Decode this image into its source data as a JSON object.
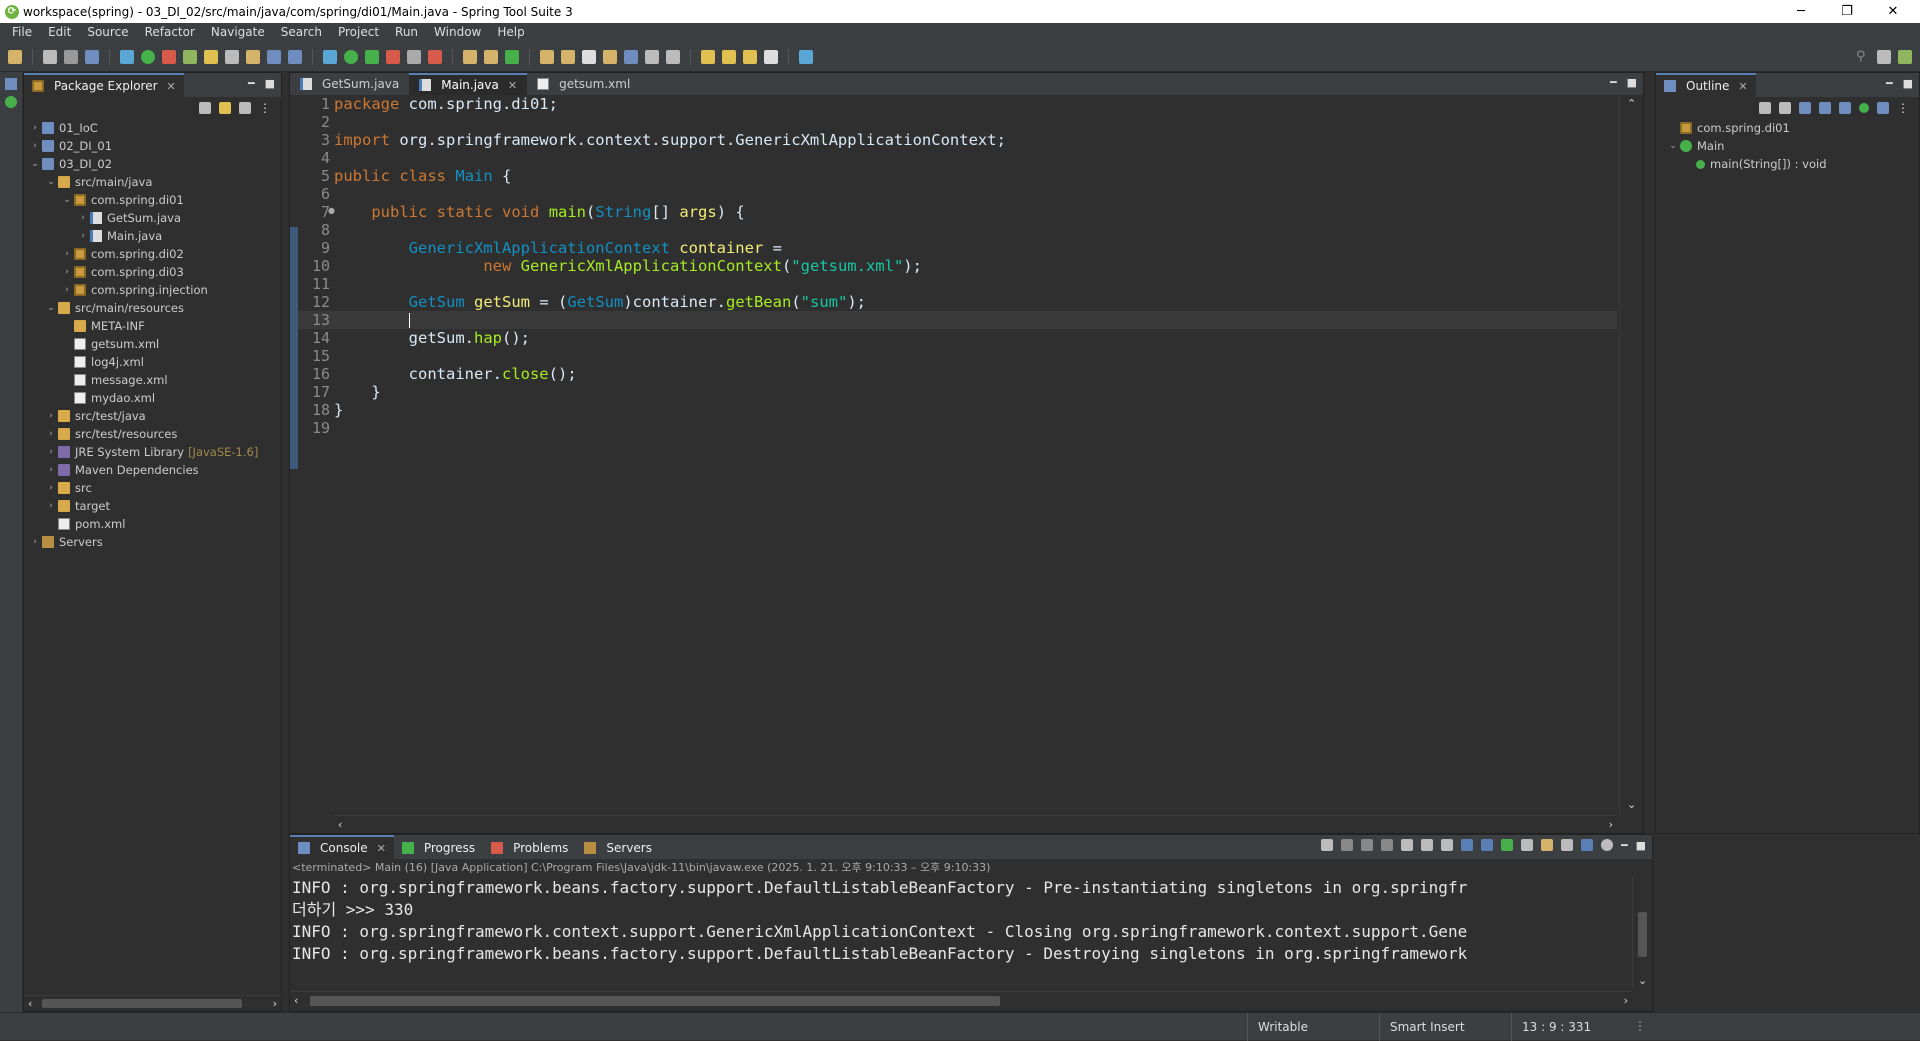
{
  "window": {
    "title": "workspace(spring) - 03_DI_02/src/main/java/com/spring/di01/Main.java - Spring Tool Suite 3",
    "minimize": "─",
    "maximize": "❐",
    "close": "✕"
  },
  "menu": [
    "File",
    "Edit",
    "Source",
    "Refactor",
    "Navigate",
    "Search",
    "Project",
    "Run",
    "Window",
    "Help"
  ],
  "package_explorer": {
    "title": "Package Explorer",
    "tree": [
      {
        "label": "01_IoC",
        "icon": "project-icon",
        "twisty": "›",
        "indent": 0
      },
      {
        "label": "02_DI_01",
        "icon": "project-icon",
        "twisty": "›",
        "indent": 0
      },
      {
        "label": "03_DI_02",
        "icon": "project-icon",
        "twisty": "⌄",
        "indent": 0
      },
      {
        "label": "src/main/java",
        "icon": "source-folder-icon",
        "twisty": "⌄",
        "indent": 1
      },
      {
        "label": "com.spring.di01",
        "icon": "package-icon",
        "twisty": "⌄",
        "indent": 2
      },
      {
        "label": "GetSum.java",
        "icon": "java-file-icon",
        "twisty": "›",
        "indent": 3
      },
      {
        "label": "Main.java",
        "icon": "java-file-icon",
        "twisty": "›",
        "indent": 3
      },
      {
        "label": "com.spring.di02",
        "icon": "package-icon",
        "twisty": "›",
        "indent": 2
      },
      {
        "label": "com.spring.di03",
        "icon": "package-icon",
        "twisty": "›",
        "indent": 2
      },
      {
        "label": "com.spring.injection",
        "icon": "package-icon",
        "twisty": "›",
        "indent": 2
      },
      {
        "label": "src/main/resources",
        "icon": "source-folder-icon",
        "twisty": "⌄",
        "indent": 1
      },
      {
        "label": "META-INF",
        "icon": "folder-icon",
        "twisty": "",
        "indent": 2
      },
      {
        "label": "getsum.xml",
        "icon": "xml-file-icon",
        "twisty": "",
        "indent": 2
      },
      {
        "label": "log4j.xml",
        "icon": "xml-file-icon",
        "twisty": "",
        "indent": 2
      },
      {
        "label": "message.xml",
        "icon": "xml-file-icon",
        "twisty": "",
        "indent": 2
      },
      {
        "label": "mydao.xml",
        "icon": "xml-file-icon",
        "twisty": "",
        "indent": 2
      },
      {
        "label": "src/test/java",
        "icon": "source-folder-icon",
        "twisty": "›",
        "indent": 1
      },
      {
        "label": "src/test/resources",
        "icon": "source-folder-icon",
        "twisty": "›",
        "indent": 1
      },
      {
        "label": "JRE System Library",
        "decoration": "[JavaSE-1.6]",
        "icon": "library-icon",
        "twisty": "›",
        "indent": 1
      },
      {
        "label": "Maven Dependencies",
        "icon": "library-icon",
        "twisty": "›",
        "indent": 1
      },
      {
        "label": "src",
        "icon": "folder-icon",
        "twisty": "›",
        "indent": 1
      },
      {
        "label": "target",
        "icon": "folder-icon",
        "twisty": "›",
        "indent": 1
      },
      {
        "label": "pom.xml",
        "icon": "xml-file-icon",
        "twisty": "",
        "indent": 1
      },
      {
        "label": "Servers",
        "icon": "servers-folder-icon",
        "twisty": "›",
        "indent": 0
      }
    ]
  },
  "editor": {
    "tabs": [
      {
        "label": "GetSum.java",
        "active": false
      },
      {
        "label": "Main.java",
        "active": true
      },
      {
        "label": "getsum.xml",
        "active": false
      }
    ],
    "line_numbers": [
      "1",
      "2",
      "3",
      "4",
      "5",
      "6",
      "7",
      "8",
      "9",
      "10",
      "11",
      "12",
      "13",
      "14",
      "15",
      "16",
      "17",
      "18",
      "19"
    ],
    "lines": [
      [
        [
          "kw",
          "package"
        ],
        [
          "plain",
          " com.spring.di01;"
        ]
      ],
      [],
      [
        [
          "kw",
          "import"
        ],
        [
          "plain",
          " org.springframework.context.support.GenericXmlApplicationContext;"
        ]
      ],
      [],
      [
        [
          "kw",
          "public"
        ],
        [
          "plain",
          " "
        ],
        [
          "kw",
          "class"
        ],
        [
          "plain",
          " "
        ],
        [
          "cls",
          "Main"
        ],
        [
          "plain",
          " {"
        ]
      ],
      [],
      [
        [
          "plain",
          "    "
        ],
        [
          "kw",
          "public"
        ],
        [
          "plain",
          " "
        ],
        [
          "kw",
          "static"
        ],
        [
          "plain",
          " "
        ],
        [
          "kw",
          "void"
        ],
        [
          "plain",
          " "
        ],
        [
          "mth",
          "main"
        ],
        [
          "plain",
          "("
        ],
        [
          "ty",
          "String"
        ],
        [
          "plain",
          "[] "
        ],
        [
          "var",
          "args"
        ],
        [
          "plain",
          ") {"
        ]
      ],
      [],
      [
        [
          "plain",
          "        "
        ],
        [
          "ty",
          "GenericXmlApplicationContext"
        ],
        [
          "plain",
          " "
        ],
        [
          "var",
          "container"
        ],
        [
          "plain",
          " ="
        ]
      ],
      [
        [
          "plain",
          "                "
        ],
        [
          "kw",
          "new"
        ],
        [
          "plain",
          " "
        ],
        [
          "mth",
          "GenericXmlApplicationContext"
        ],
        [
          "plain",
          "("
        ],
        [
          "str",
          "\"getsum.xml\""
        ],
        [
          "plain",
          ");"
        ]
      ],
      [],
      [
        [
          "plain",
          "        "
        ],
        [
          "ty",
          "GetSum"
        ],
        [
          "plain",
          " "
        ],
        [
          "var",
          "getSum"
        ],
        [
          "plain",
          " = ("
        ],
        [
          "ty",
          "GetSum"
        ],
        [
          "plain",
          ")container."
        ],
        [
          "mth",
          "getBean"
        ],
        [
          "plain",
          "("
        ],
        [
          "str",
          "\"sum\""
        ],
        [
          "plain",
          ");"
        ]
      ],
      [
        [
          "plain",
          "        "
        ]
      ],
      [
        [
          "plain",
          "        getSum."
        ],
        [
          "mth",
          "hap"
        ],
        [
          "plain",
          "();"
        ]
      ],
      [],
      [
        [
          "plain",
          "        container."
        ],
        [
          "mth",
          "close"
        ],
        [
          "plain",
          "();"
        ]
      ],
      [
        [
          "plain",
          "    }"
        ]
      ],
      [
        [
          "plain",
          "}"
        ]
      ],
      []
    ],
    "current_line": 13
  },
  "outline": {
    "title": "Outline",
    "items": [
      {
        "label": "com.spring.di01",
        "icon": "package-icon"
      },
      {
        "label": "Main",
        "icon": "class-icon"
      },
      {
        "label": "main(String[]) : void",
        "icon": "method-icon"
      }
    ]
  },
  "console": {
    "tabs": [
      {
        "label": "Console",
        "icon": "console-icon",
        "active": true
      },
      {
        "label": "Progress",
        "icon": "progress-icon",
        "active": false
      },
      {
        "label": "Problems",
        "icon": "problems-icon",
        "active": false
      },
      {
        "label": "Servers",
        "icon": "servers-icon",
        "active": false
      }
    ],
    "header": "<terminated> Main (16) [Java Application] C:\\Program Files\\Java\\jdk-11\\bin\\javaw.exe  (2025. 1. 21. 오후 9:10:33 – 오후 9:10:33)",
    "lines": [
      "INFO : org.springframework.beans.factory.support.DefaultListableBeanFactory - Pre-instantiating singletons in org.springfr",
      "더하기 >>> 330",
      "INFO : org.springframework.context.support.GenericXmlApplicationContext - Closing org.springframework.context.support.Gene",
      "INFO : org.springframework.beans.factory.support.DefaultListableBeanFactory - Destroying singletons in org.springframework"
    ]
  },
  "status": {
    "writable": "Writable",
    "insert_mode": "Smart Insert",
    "position": "13 : 9 : 331"
  },
  "colors": {
    "background": "#2f2f2f",
    "chrome": "#3c3f41",
    "keyword": "#cc7832",
    "type": "#1290c3",
    "variable": "#f3ec79",
    "string": "#17c6a3",
    "method": "#a7ec21"
  }
}
